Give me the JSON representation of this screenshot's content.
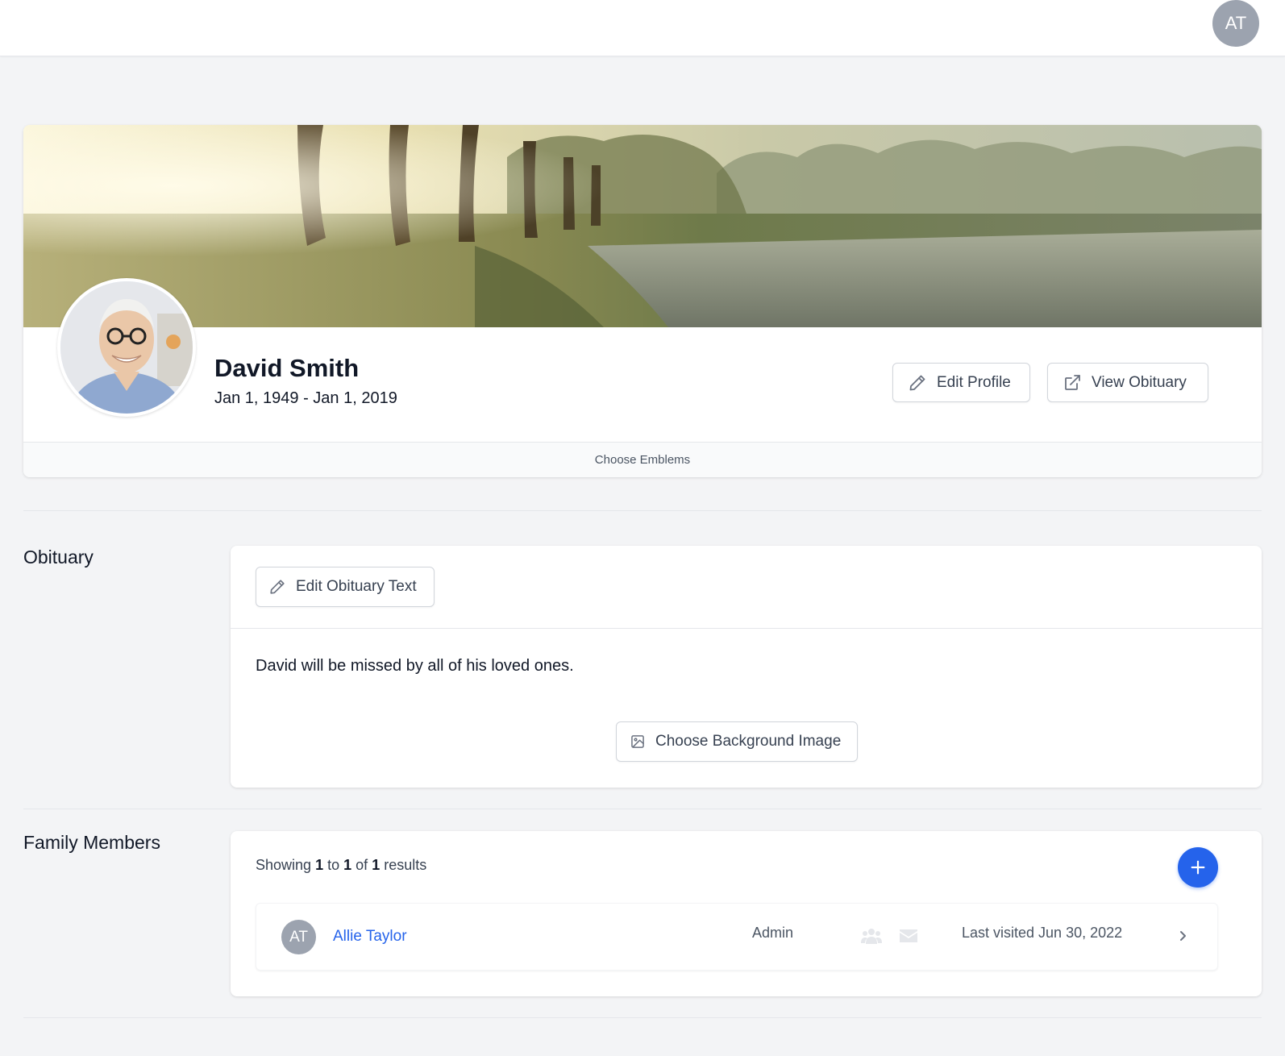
{
  "header": {
    "user_initials": "AT"
  },
  "profile": {
    "name": "David Smith",
    "dates": "Jan 1, 1949 - Jan 1, 2019",
    "edit_profile_label": "Edit Profile",
    "view_obituary_label": "View Obituary",
    "choose_emblems_label": "Choose Emblems"
  },
  "obituary": {
    "section_title": "Obituary",
    "edit_text_label": "Edit Obituary Text",
    "text": "David will be missed by all of his loved ones.",
    "choose_background_label": "Choose Background Image"
  },
  "family": {
    "section_title": "Family Members",
    "results_prefix": "Showing",
    "results_from": "1",
    "results_to_word": "to",
    "results_to": "1",
    "results_of_word": "of",
    "results_total": "1",
    "results_suffix": "results",
    "members": [
      {
        "initials": "AT",
        "name": "Allie Taylor",
        "role": "Admin",
        "last_visited": "Last visited Jun 30, 2022"
      }
    ]
  },
  "colors": {
    "accent": "#2563eb",
    "avatar_bg": "#9ca3af",
    "page_bg": "#f3f4f6"
  }
}
